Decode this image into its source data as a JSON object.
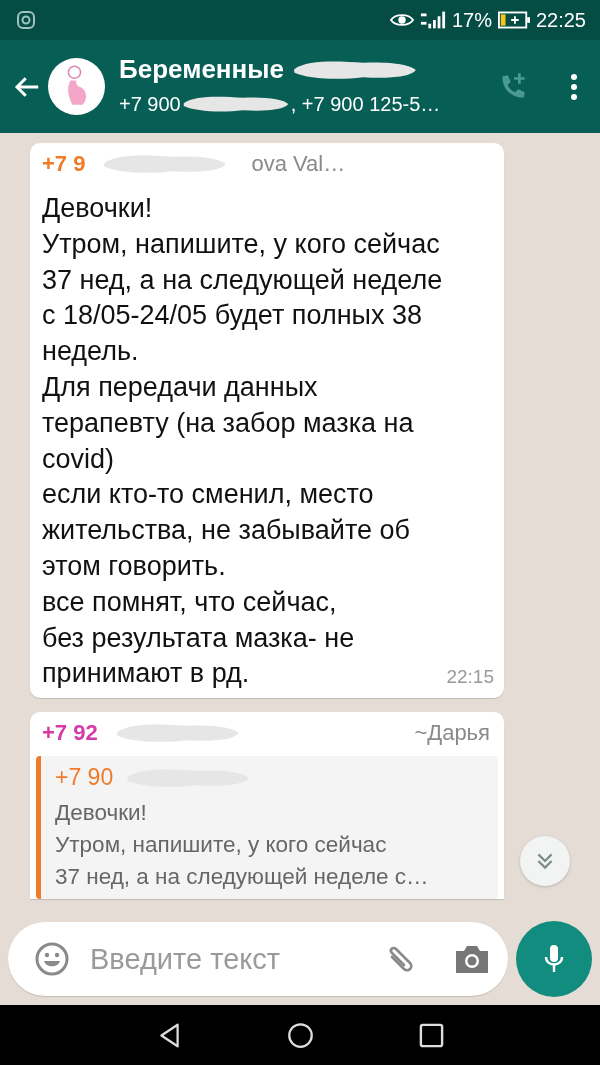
{
  "status_bar": {
    "battery": "17%",
    "time": "22:25"
  },
  "header": {
    "title": "Беременные",
    "subtitle_start": "+7 900",
    "subtitle_end": ", +7 900 125-5…"
  },
  "messages": [
    {
      "kind": "text",
      "sender_phone": "+7 9",
      "sender_name": "ova Val…",
      "color": "#f07b2b",
      "text": "Девочки!\nУтром, напишите, у кого сейчас\n37 нед, а на следующей неделе\nс 18/05-24/05 будет полных 38\nнедель.\nДля передачи данных\nтерапевту (на забор мазка на\ncovid)\nесли кто-то сменил, место\nжительства, не забывайте об\nэтом говорить.\nвсе помнят, что сейчас,\nбез результата мазка- не\nпринимают в рд.",
      "time": "22:15"
    },
    {
      "kind": "reply",
      "sender_phone": "+7 92",
      "sender_name": "~Дарья",
      "color": "#d63aa8",
      "quote": {
        "sender": "+7 90",
        "color": "#f07b2b",
        "text": "Девочки!\nУтром, напишите, у кого сейчас\n37 нед, а на следующей неделе с…"
      }
    }
  ],
  "composer": {
    "placeholder": "Введите текст"
  }
}
